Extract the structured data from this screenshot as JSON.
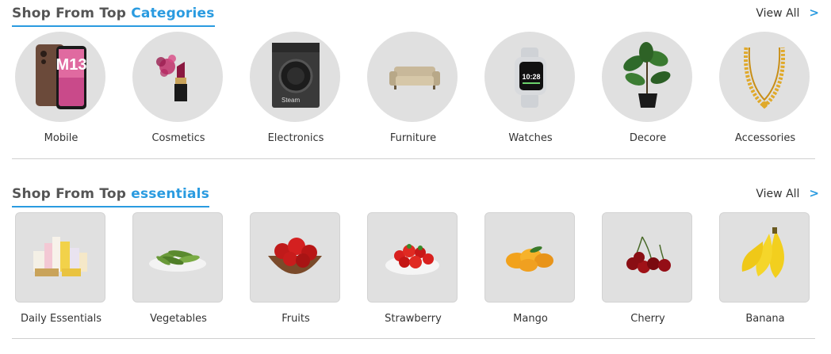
{
  "categories_section": {
    "title_prefix": "Shop From Top ",
    "title_accent": "Categories",
    "view_all": "View All",
    "items": [
      {
        "label": "Mobile",
        "icon": "phone-icon"
      },
      {
        "label": "Cosmetics",
        "icon": "lipstick-icon"
      },
      {
        "label": "Electronics",
        "icon": "washing-machine-icon"
      },
      {
        "label": "Furniture",
        "icon": "sofa-icon"
      },
      {
        "label": "Watches",
        "icon": "smartwatch-icon"
      },
      {
        "label": "Decore",
        "icon": "plant-icon"
      },
      {
        "label": "Accessories",
        "icon": "necklace-icon"
      }
    ]
  },
  "essentials_section": {
    "title_prefix": "Shop From Top ",
    "title_accent": "essentials",
    "view_all": "View All",
    "items": [
      {
        "label": "Daily Essentials",
        "icon": "toiletries-icon"
      },
      {
        "label": "Vegetables",
        "icon": "beans-icon"
      },
      {
        "label": "Fruits",
        "icon": "apple-bowl-icon"
      },
      {
        "label": "Strawberry",
        "icon": "strawberry-icon"
      },
      {
        "label": "Mango",
        "icon": "mango-icon"
      },
      {
        "label": "Cherry",
        "icon": "cherry-icon"
      },
      {
        "label": "Banana",
        "icon": "banana-icon"
      }
    ]
  },
  "product_text": {
    "phone_model": "M13",
    "washer_brand": "Steam",
    "watch_time": "10:28"
  },
  "colors": {
    "accent": "#2a9be0",
    "tile_bg": "#e0e0e0"
  }
}
